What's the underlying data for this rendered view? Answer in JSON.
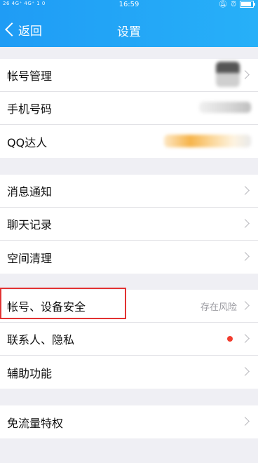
{
  "status_bar": {
    "left": "26 4G⁺ 4G⁺ 1 0",
    "time": "16:59"
  },
  "nav": {
    "back_label": "返回",
    "title": "设置"
  },
  "groups": [
    {
      "items": [
        {
          "label": "帐号管理"
        },
        {
          "label": "手机号码"
        },
        {
          "label": "QQ达人"
        }
      ]
    },
    {
      "items": [
        {
          "label": "消息通知"
        },
        {
          "label": "聊天记录"
        },
        {
          "label": "空间清理"
        }
      ]
    },
    {
      "items": [
        {
          "label": "帐号、设备安全",
          "value": "存在风险"
        },
        {
          "label": "联系人、隐私"
        },
        {
          "label": "辅助功能"
        }
      ]
    },
    {
      "items": [
        {
          "label": "免流量特权"
        }
      ]
    }
  ],
  "colors": {
    "nav_gradient_start": "#1f9cf5",
    "nav_gradient_end": "#27b0f8",
    "red_dot": "#f23d2f",
    "highlight_border": "#e23232"
  }
}
